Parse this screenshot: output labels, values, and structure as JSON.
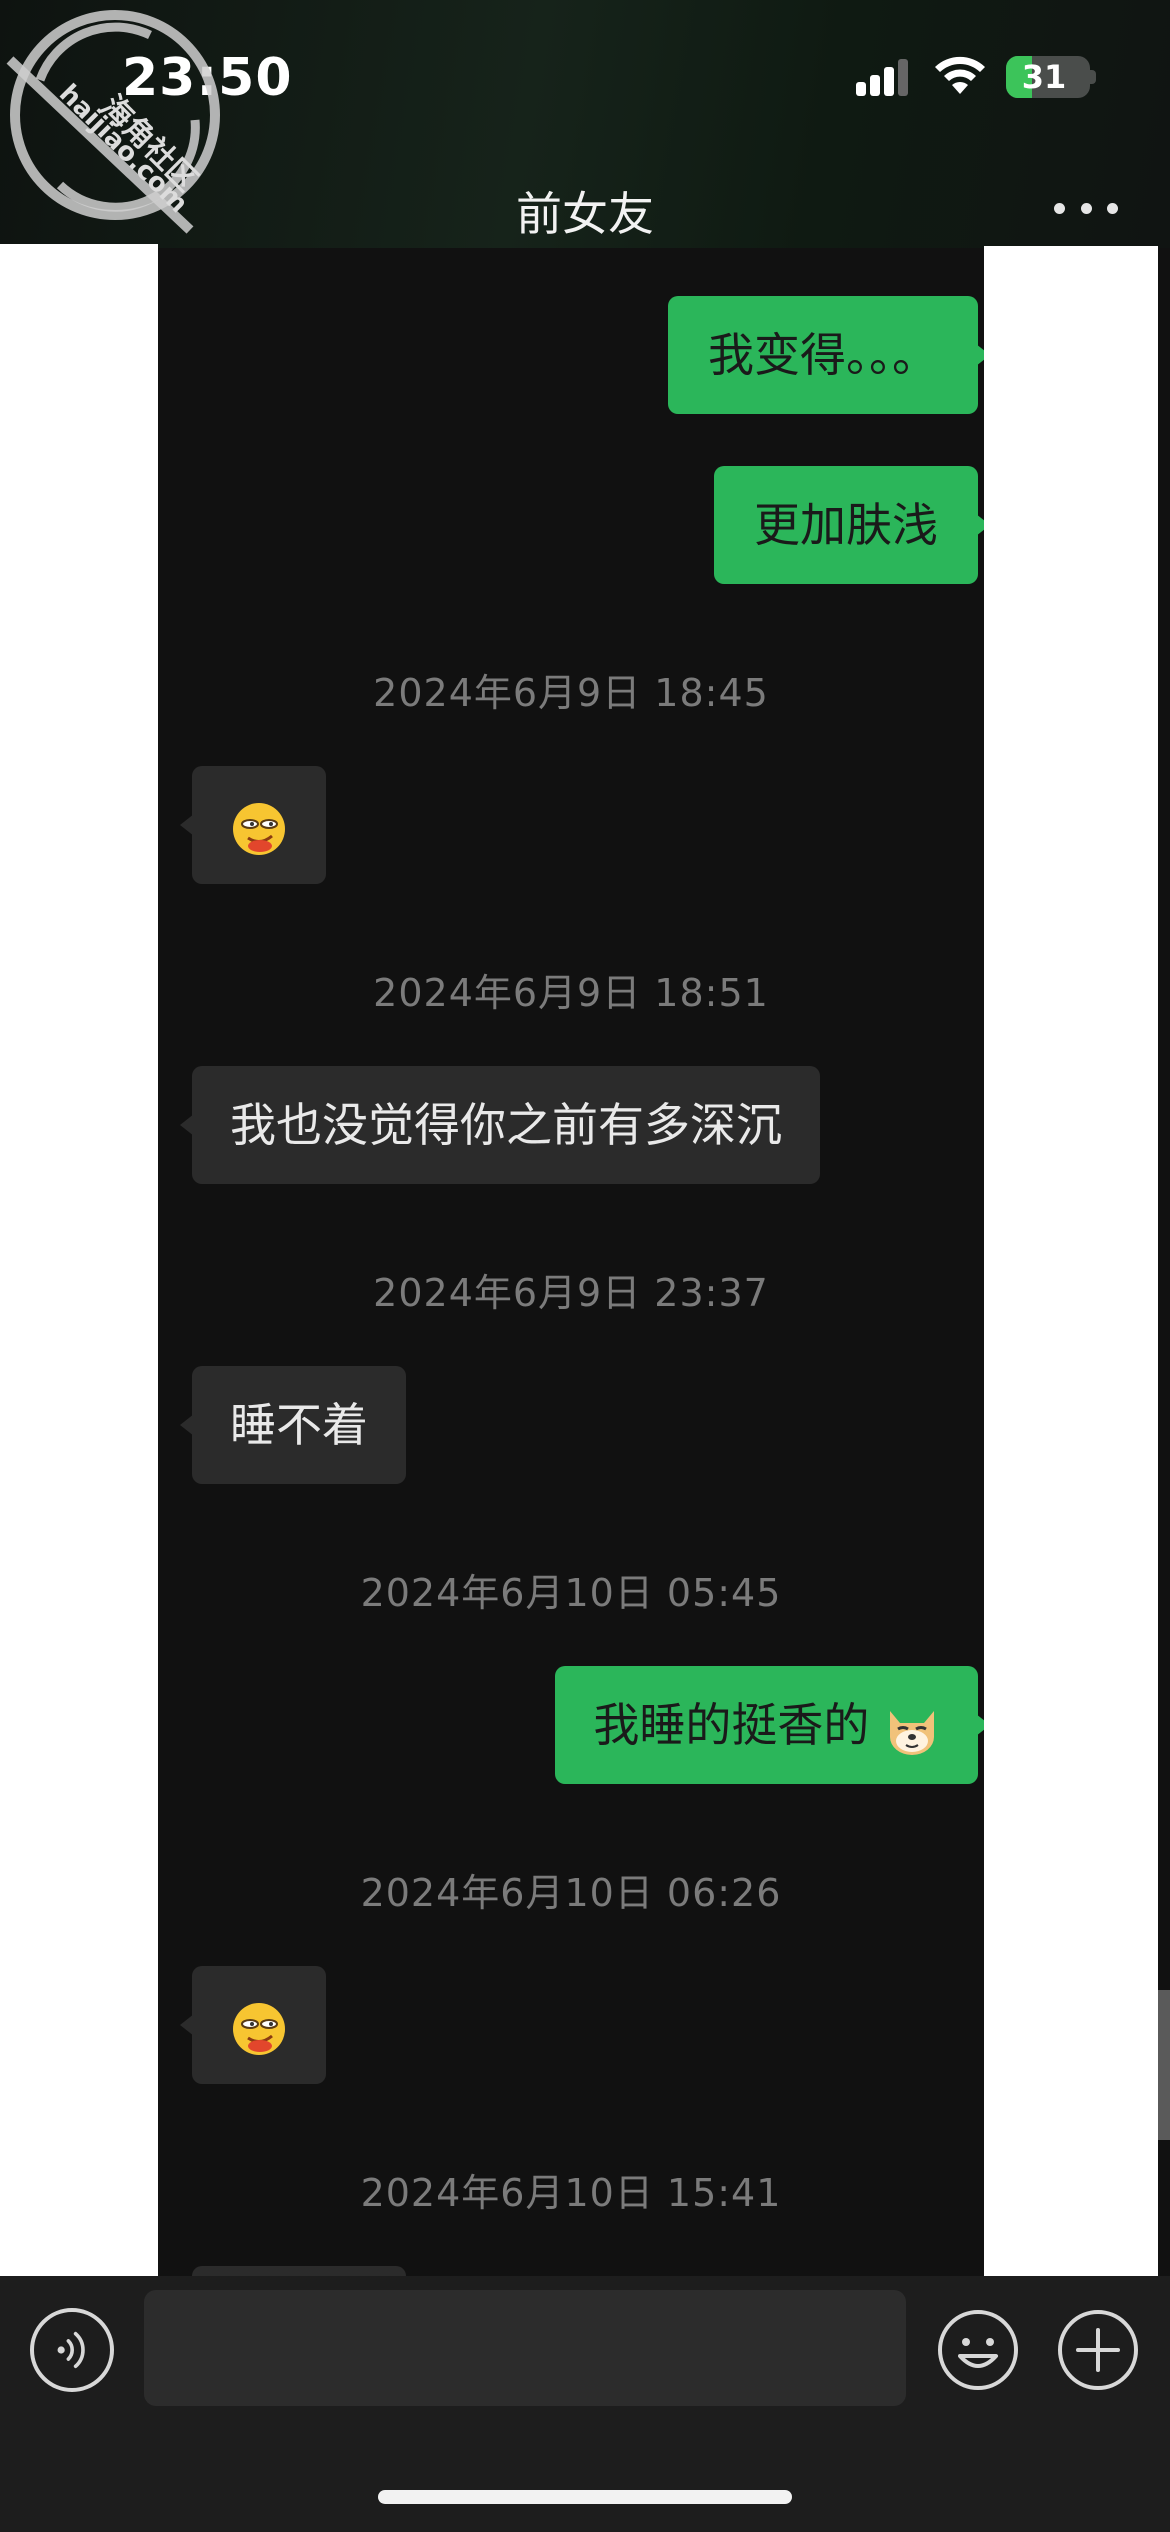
{
  "status_bar": {
    "time": "23:50",
    "battery_level": "31",
    "battery_fraction": 0.31
  },
  "header": {
    "title": "前女友",
    "more_icon": "ellipsis-icon"
  },
  "watermark": {
    "line1": "海角社区",
    "line2": "haijiao.com"
  },
  "messages": [
    {
      "type": "sent",
      "text": "我变得。。。"
    },
    {
      "type": "sent",
      "text": "更加肤浅"
    },
    {
      "type": "timestamp",
      "text": "2024年6月9日 18:45"
    },
    {
      "type": "recv",
      "sticker": "smirk-face-emoji"
    },
    {
      "type": "timestamp",
      "text": "2024年6月9日 18:51"
    },
    {
      "type": "recv",
      "text": "我也没觉得你之前有多深沉"
    },
    {
      "type": "timestamp",
      "text": "2024年6月9日 23:37"
    },
    {
      "type": "recv",
      "text": "睡不着"
    },
    {
      "type": "timestamp",
      "text": "2024年6月10日 05:45"
    },
    {
      "type": "sent",
      "text": "我睡的挺香的",
      "sticker": "doge-emoji"
    },
    {
      "type": "timestamp",
      "text": "2024年6月10日 06:26"
    },
    {
      "type": "recv",
      "sticker": "smirk-face-emoji"
    },
    {
      "type": "timestamp",
      "text": "2024年6月10日 15:41"
    }
  ],
  "input_bar": {
    "voice_icon": "voice-icon",
    "input_value": "",
    "emoji_icon": "smile-icon",
    "plus_icon": "plus-icon"
  },
  "colors": {
    "sent_bubble": "#2bb65a",
    "recv_bubble": "#2b2b2b",
    "background": "#111111",
    "timestamp": "#7b7b7b"
  }
}
